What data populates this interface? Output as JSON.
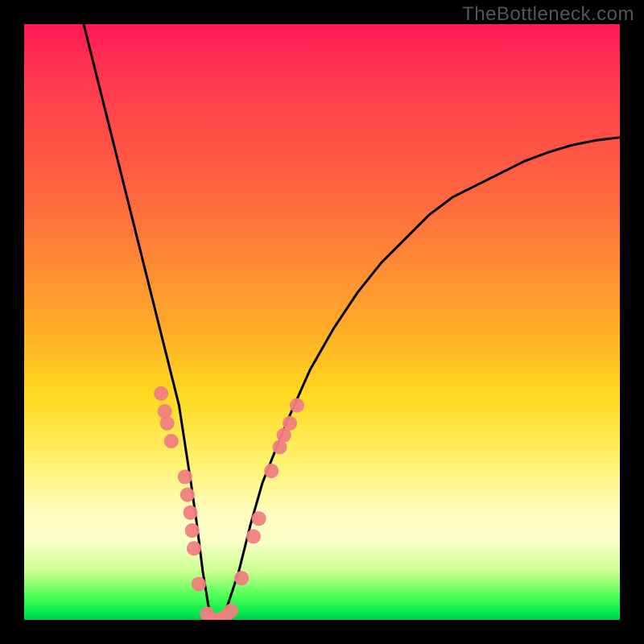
{
  "watermark": "TheBottleneck.com",
  "chart_data": {
    "type": "line",
    "title": "",
    "xlabel": "",
    "ylabel": "",
    "xlim": [
      0,
      100
    ],
    "ylim": [
      0,
      100
    ],
    "grid": false,
    "legend": false,
    "series": [
      {
        "name": "bottleneck-curve",
        "x": [
          10,
          12,
          14,
          16,
          18,
          20,
          22,
          24,
          26,
          28,
          29,
          30,
          31,
          32,
          33,
          34,
          36,
          38,
          40,
          44,
          48,
          52,
          56,
          60,
          64,
          68,
          72,
          76,
          80,
          84,
          88,
          92,
          96,
          100
        ],
        "y": [
          100,
          92,
          84,
          76,
          68,
          60,
          52,
          44,
          36,
          23,
          16,
          8,
          2,
          0,
          0,
          2,
          8,
          16,
          23,
          33,
          42,
          49,
          55,
          60,
          64,
          68,
          71,
          73,
          75,
          77,
          78.5,
          79.7,
          80.5,
          81
        ]
      }
    ],
    "markers": {
      "name": "highlighted-points",
      "color": "#f08080",
      "points": [
        {
          "x": 23.0,
          "y": 38.0
        },
        {
          "x": 23.6,
          "y": 35.0
        },
        {
          "x": 24.0,
          "y": 33.0
        },
        {
          "x": 24.7,
          "y": 30.0
        },
        {
          "x": 27.0,
          "y": 24.0
        },
        {
          "x": 27.4,
          "y": 21.0
        },
        {
          "x": 27.9,
          "y": 18.0
        },
        {
          "x": 28.2,
          "y": 15.0
        },
        {
          "x": 28.5,
          "y": 12.0
        },
        {
          "x": 29.3,
          "y": 6.0
        },
        {
          "x": 30.7,
          "y": 1.0
        },
        {
          "x": 31.6,
          "y": 0.0
        },
        {
          "x": 32.7,
          "y": 0.0
        },
        {
          "x": 33.7,
          "y": 0.5
        },
        {
          "x": 34.7,
          "y": 1.5
        },
        {
          "x": 36.5,
          "y": 7.0
        },
        {
          "x": 38.5,
          "y": 14.0
        },
        {
          "x": 39.4,
          "y": 17.0
        },
        {
          "x": 41.5,
          "y": 25.0
        },
        {
          "x": 42.9,
          "y": 29.0
        },
        {
          "x": 43.6,
          "y": 31.0
        },
        {
          "x": 44.6,
          "y": 33.0
        },
        {
          "x": 45.8,
          "y": 36.0
        }
      ]
    },
    "background_gradient_stops": [
      {
        "pos": 0.0,
        "color": "#ff1a57"
      },
      {
        "pos": 0.1,
        "color": "#ff3b4e"
      },
      {
        "pos": 0.3,
        "color": "#ff6a3e"
      },
      {
        "pos": 0.5,
        "color": "#ffa829"
      },
      {
        "pos": 0.62,
        "color": "#ffd81f"
      },
      {
        "pos": 0.73,
        "color": "#fff169"
      },
      {
        "pos": 0.82,
        "color": "#fffdbf"
      },
      {
        "pos": 0.87,
        "color": "#f7ffc6"
      },
      {
        "pos": 0.92,
        "color": "#c8ff8e"
      },
      {
        "pos": 0.96,
        "color": "#4eff56"
      },
      {
        "pos": 0.99,
        "color": "#00e84d"
      },
      {
        "pos": 1.0,
        "color": "#00c74c"
      }
    ]
  }
}
